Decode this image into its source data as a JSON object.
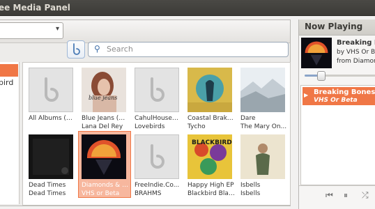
{
  "window": {
    "title": "ee Media Panel"
  },
  "toolbar": {
    "search_placeholder": "Search"
  },
  "sidebar": {
    "items": [
      {
        "label": ""
      },
      {
        "label": "bird"
      }
    ]
  },
  "albums": [
    {
      "title": "All Albums (16)",
      "artist": "",
      "art": "placeholder",
      "selected": false
    },
    {
      "title": "Blue Jeans (Re...",
      "artist": "Lana Del Rey",
      "art": "lana",
      "selected": false
    },
    {
      "title": "CahulHouseM...",
      "artist": "Lovebirds",
      "art": "placeholder",
      "selected": false
    },
    {
      "title": "Coastal Brake ...",
      "artist": "Tycho",
      "art": "tycho",
      "selected": false
    },
    {
      "title": "Dare",
      "artist": "The Mary On...",
      "art": "dare",
      "selected": false
    },
    {
      "title": "Dead Times",
      "artist": "Dead Times",
      "art": "deadtimes",
      "selected": false
    },
    {
      "title": "Diamonds & D...",
      "artist": "VHS or Beta",
      "art": "vhs",
      "selected": true
    },
    {
      "title": "FreeIndie.Co...",
      "artist": "BRAHMS",
      "art": "placeholder",
      "selected": false
    },
    {
      "title": "Happy High EP",
      "artist": "Blackbird Blac...",
      "art": "blackbird",
      "selected": false
    },
    {
      "title": "Isbells",
      "artist": "Isbells",
      "art": "isbells",
      "selected": false
    }
  ],
  "now_playing": {
    "header": "Now Playing",
    "title": "Breaking Bo",
    "by_line": "by VHS Or Beta",
    "from_line": "from Diamon",
    "progress": 0.23,
    "queue": [
      {
        "title": "Breaking Bones",
        "artist": "VHS Or Beta",
        "playing": true
      }
    ]
  },
  "colors": {
    "accent": "#f07746",
    "selected_tile": "#f7b79e",
    "titlebar": "#3c3b37"
  },
  "icons": {
    "search": "search-icon",
    "brand": "media-brand-icon",
    "combo": "chevron-down-icon",
    "prev": "previous-icon",
    "pause": "pause-icon",
    "shuffle": "shuffle-icon",
    "play": "play-indicator-icon"
  }
}
